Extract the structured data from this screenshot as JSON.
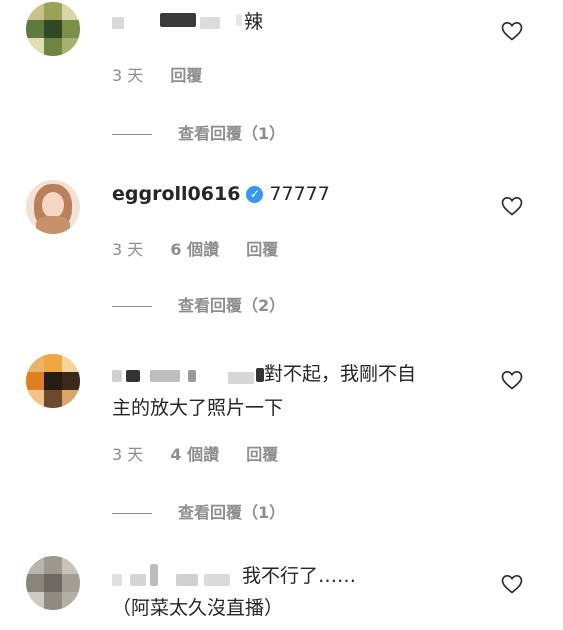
{
  "comments": [
    {
      "text": "辣",
      "time": "3 天",
      "likes": "",
      "reply": "回覆",
      "view_replies": "查看回覆（1）"
    },
    {
      "username": "eggroll0616",
      "verified_mark": "✓",
      "text": "77777",
      "time": "3 天",
      "likes": "6 個讚",
      "reply": "回覆",
      "view_replies": "查看回覆（2）"
    },
    {
      "text_line1": "對不起，我剛不自",
      "text_line2": "主的放大了照片一下",
      "time": "3 天",
      "likes": "4 個讚",
      "reply": "回覆",
      "view_replies": "查看回覆（1）"
    },
    {
      "text_line1": "我不行了……",
      "text_line2": "（阿菜太久沒直播）"
    }
  ],
  "icons": {
    "like": "heart-outline-icon",
    "verified": "verified-badge-icon"
  },
  "colors": {
    "text": "#262626",
    "meta": "#8e8e8e",
    "verified": "#3897f0"
  }
}
